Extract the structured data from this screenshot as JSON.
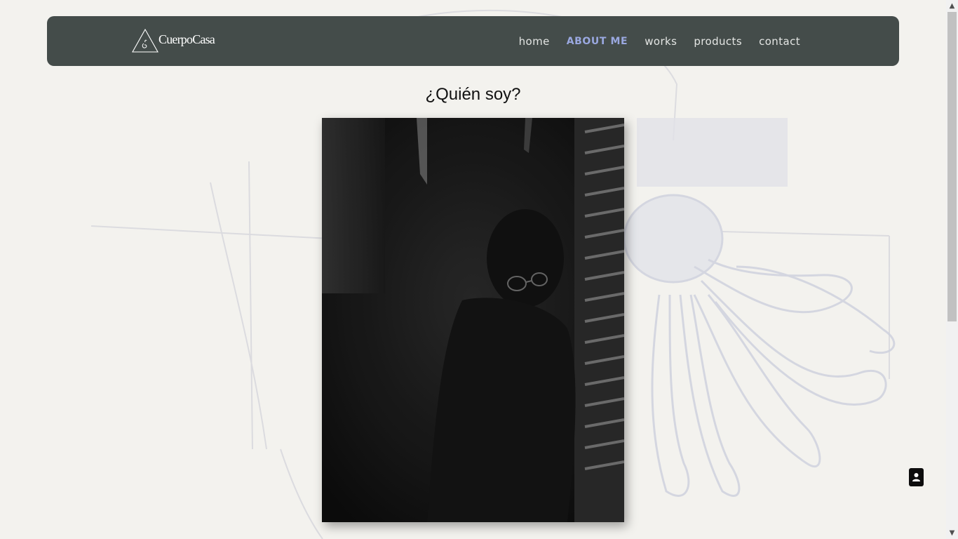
{
  "header": {
    "logo_text": "CuerpoCasa",
    "nav": [
      {
        "label": "home",
        "active": false
      },
      {
        "label": "ABOUT ME",
        "active": true
      },
      {
        "label": "works",
        "active": false
      },
      {
        "label": "products",
        "active": false
      },
      {
        "label": "contact",
        "active": false
      }
    ]
  },
  "main": {
    "title": "¿Quién soy?"
  },
  "fab": {
    "icon": "contact-card-icon"
  },
  "scrollbar": {
    "up_glyph": "▲",
    "down_glyph": "▼"
  },
  "colors": {
    "header_bg": "#444c4a",
    "nav_active": "#9aa8e0",
    "page_bg": "#f3f2ee"
  }
}
